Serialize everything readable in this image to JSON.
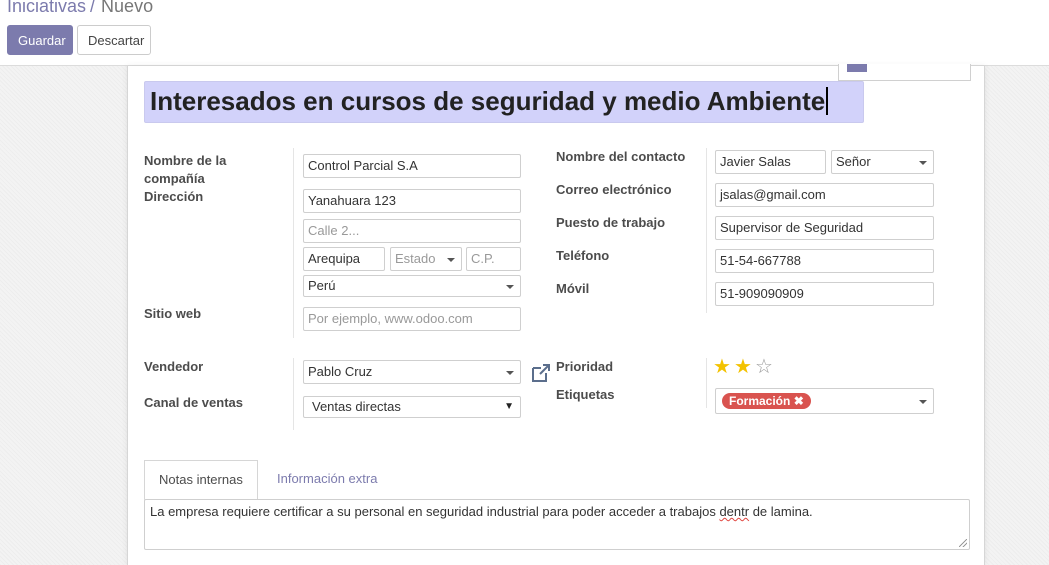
{
  "breadcrumb": {
    "parent": "Iniciativas",
    "separator": "/",
    "current": "Nuevo"
  },
  "buttons": {
    "save": "Guardar",
    "discard": "Descartar"
  },
  "title": "Interesados en cursos de seguridad y medio Ambiente",
  "left": {
    "company_label": "Nombre de la compañía",
    "company": "Control Parcial S.A",
    "address_label": "Dirección",
    "street": "Yanahuara 123",
    "street2_placeholder": "Calle 2...",
    "city": "Arequipa",
    "state_placeholder": "Estado",
    "zip_placeholder": "C.P.",
    "country": "Perú",
    "website_label": "Sitio web",
    "website_placeholder": "Por ejemplo, www.odoo.com",
    "salesperson_label": "Vendedor",
    "salesperson": "Pablo Cruz",
    "channel_label": "Canal de ventas",
    "channel": "Ventas directas",
    "channel_arrow": "▼"
  },
  "right": {
    "contact_label": "Nombre del contacto",
    "contact_name": "Javier Salas",
    "title": "Señor",
    "email_label": "Correo electrónico",
    "email": "jsalas@gmail.com",
    "job_label": "Puesto de trabajo",
    "job": "Supervisor de Seguridad",
    "phone_label": "Teléfono",
    "phone": "51-54-667788",
    "mobile_label": "Móvil",
    "mobile": "51-909090909",
    "priority_label": "Prioridad",
    "priority": 2,
    "priority_max": 3,
    "tags_label": "Etiquetas",
    "tag": "Formación",
    "tag_remove": "✖",
    "tag_color": "#d9534f"
  },
  "tabs": [
    "Notas internas",
    "Información extra"
  ],
  "notes": {
    "before": "La empresa requiere certificar a su personal en seguridad industrial para poder acceder a trabajos ",
    "misspelled": "dentr",
    "after": " de lamina."
  },
  "colors": {
    "accent": "#7c7bad",
    "title_highlight": "#d2d2fa",
    "star": "#f3c200"
  }
}
